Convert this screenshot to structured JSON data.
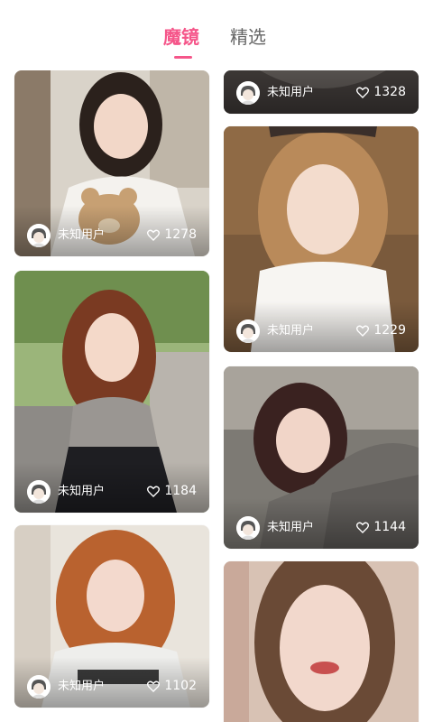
{
  "tabs": [
    {
      "label": "魔镜",
      "active": true
    },
    {
      "label": "精选",
      "active": false
    }
  ],
  "accent_color": "#f5568a",
  "cards": [
    {
      "user": "未知用户",
      "likes": "1278",
      "avatar_icon": "default-avatar-icon",
      "like_icon": "heart-outline-icon"
    },
    {
      "user": "未知用户",
      "likes": "1328",
      "avatar_icon": "default-avatar-icon",
      "like_icon": "heart-outline-icon"
    },
    {
      "user": "未知用户",
      "likes": "1229",
      "avatar_icon": "default-avatar-icon",
      "like_icon": "heart-outline-icon"
    },
    {
      "user": "未知用户",
      "likes": "1184",
      "avatar_icon": "default-avatar-icon",
      "like_icon": "heart-outline-icon"
    },
    {
      "user": "未知用户",
      "likes": "1144",
      "avatar_icon": "default-avatar-icon",
      "like_icon": "heart-outline-icon"
    },
    {
      "user": "未知用户",
      "likes": "1102",
      "avatar_icon": "default-avatar-icon",
      "like_icon": "heart-outline-icon"
    },
    {
      "user": "",
      "likes": "",
      "avatar_icon": "",
      "like_icon": ""
    }
  ]
}
